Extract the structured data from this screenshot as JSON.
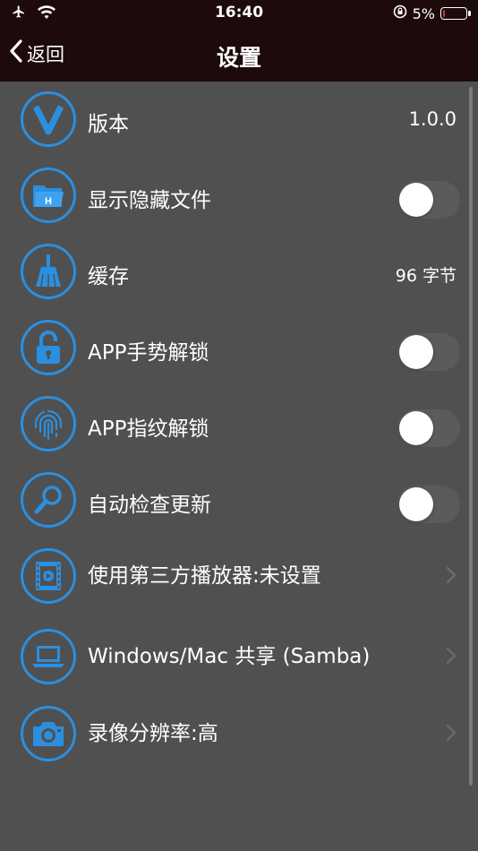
{
  "status_bar": {
    "time": "16:40",
    "battery_percent": "5%",
    "battery_level": 0.05,
    "icons": [
      "airplane-icon",
      "wifi-icon",
      "orientation-lock-icon",
      "battery-icon"
    ]
  },
  "nav": {
    "back_label": "返回",
    "title": "设置"
  },
  "colors": {
    "accent": "#2b8fe0",
    "background": "#505050",
    "navbar": "#1d0a0a"
  },
  "settings": {
    "version": {
      "label": "版本",
      "value": "1.0.0",
      "icon": "version-v-icon"
    },
    "show_hidden": {
      "label": "显示隐藏文件",
      "toggle": false,
      "icon": "hidden-folder-icon"
    },
    "cache": {
      "label": "缓存",
      "value": "96 字节",
      "icon": "broom-icon"
    },
    "gesture_unlock": {
      "label": "APP手势解锁",
      "toggle": false,
      "icon": "lock-icon"
    },
    "fingerprint_unlock": {
      "label": "APP指纹解锁",
      "toggle": false,
      "icon": "fingerprint-icon"
    },
    "auto_update": {
      "label": "自动检查更新",
      "toggle": false,
      "icon": "magnifier-icon"
    },
    "player": {
      "label": "使用第三方播放器:未设置",
      "icon": "film-icon"
    },
    "samba": {
      "label": "Windows/Mac 共享 (Samba)",
      "icon": "laptop-icon"
    },
    "resolution": {
      "label": "录像分辨率:高",
      "icon": "camera-icon"
    }
  }
}
